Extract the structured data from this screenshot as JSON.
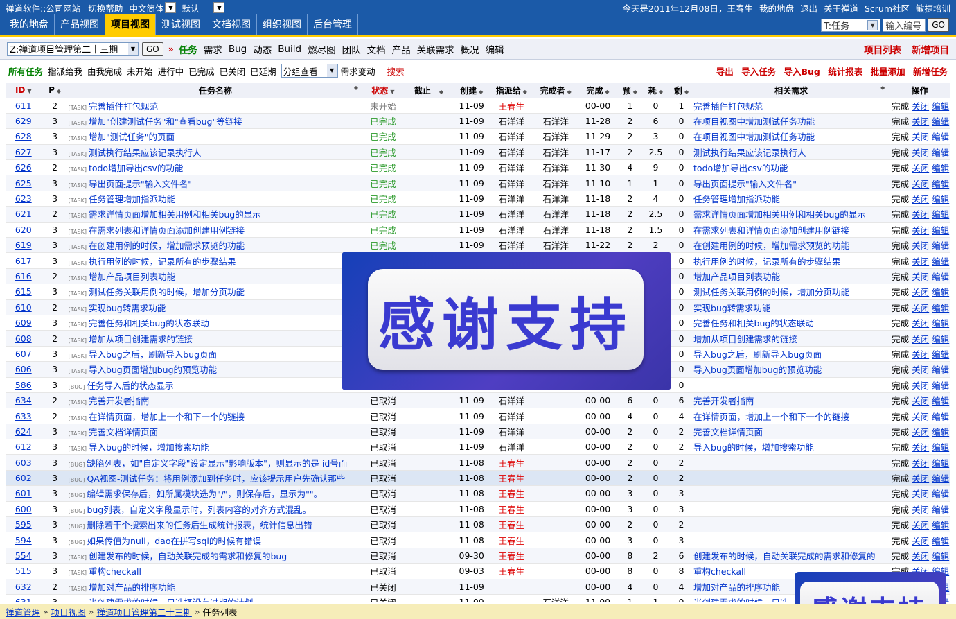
{
  "topbar": {
    "links": [
      "禅道软件::公司网站",
      "切换帮助"
    ],
    "lang": "中文简体",
    "theme": "默认",
    "right": [
      "今天是2011年12月08日，王春生",
      "我的地盘",
      "退出",
      "关于禅道",
      "Scrum社区",
      "敏捷培训"
    ]
  },
  "mainnav": {
    "tabs": [
      "我的地盘",
      "产品视图",
      "项目视图",
      "测试视图",
      "文档视图",
      "组织视图",
      "后台管理"
    ],
    "active": 2,
    "search_type": "T:任务",
    "search_placeholder": "输入编号",
    "go": "GO"
  },
  "projbar": {
    "project": "Z:禅道项目管理第二十三期",
    "go": "GO",
    "sep": "»",
    "items": [
      "任务",
      "需求",
      "Bug",
      "动态",
      "Build",
      "燃尽图",
      "团队",
      "文档",
      "产品",
      "关联需求",
      "概况",
      "编辑"
    ],
    "right": [
      "项目列表",
      "新增项目"
    ]
  },
  "filterbar": {
    "items": [
      "所有任务",
      "指派给我",
      "由我完成",
      "未开始",
      "进行中",
      "已完成",
      "已关闭",
      "已延期"
    ],
    "group": "分组查看",
    "story_change": "需求变动",
    "search": "搜索",
    "right": [
      "导出",
      "导入任务",
      "导入Bug",
      "统计报表",
      "批量添加",
      "新增任务"
    ]
  },
  "table": {
    "headers": [
      "ID",
      "P",
      "任务名称",
      "状态",
      "截止",
      "创建",
      "指派给",
      "完成者",
      "完成",
      "预",
      "耗",
      "剩",
      "相关需求",
      "操作"
    ],
    "ops": [
      "完成",
      "关闭",
      "编辑"
    ],
    "rows": [
      {
        "id": "611",
        "p": "2",
        "tag": "[TASK]",
        "name": "完善插件打包规范",
        "status": "未开始",
        "deadline": "",
        "created": "11-09",
        "assigned": "王春生",
        "assigned_red": true,
        "finisher": "",
        "finished": "00-00",
        "est": "1",
        "consumed": "0",
        "left": "1",
        "story": "完善插件打包规范"
      },
      {
        "id": "629",
        "p": "3",
        "tag": "[TASK]",
        "name": "增加\"创建测试任务\"和\"查看bug\"等链接",
        "status": "已完成",
        "deadline": "",
        "created": "11-09",
        "assigned": "石洋洋",
        "assigned_red": false,
        "finisher": "石洋洋",
        "finished": "11-28",
        "est": "2",
        "consumed": "6",
        "left": "0",
        "story": "在项目视图中增加测试任务功能"
      },
      {
        "id": "628",
        "p": "3",
        "tag": "[TASK]",
        "name": "增加\"测试任务\"的页面",
        "status": "已完成",
        "deadline": "",
        "created": "11-09",
        "assigned": "石洋洋",
        "assigned_red": false,
        "finisher": "石洋洋",
        "finished": "11-29",
        "est": "2",
        "consumed": "3",
        "left": "0",
        "story": "在项目视图中增加测试任务功能"
      },
      {
        "id": "627",
        "p": "3",
        "tag": "[TASK]",
        "name": "测试执行结果应该记录执行人",
        "status": "已完成",
        "deadline": "",
        "created": "11-09",
        "assigned": "石洋洋",
        "assigned_red": false,
        "finisher": "石洋洋",
        "finished": "11-17",
        "est": "2",
        "consumed": "2.5",
        "left": "0",
        "story": "测试执行结果应该记录执行人"
      },
      {
        "id": "626",
        "p": "2",
        "tag": "[TASK]",
        "name": "todo增加导出csv的功能",
        "status": "已完成",
        "deadline": "",
        "created": "11-09",
        "assigned": "石洋洋",
        "assigned_red": false,
        "finisher": "石洋洋",
        "finished": "11-30",
        "est": "4",
        "consumed": "9",
        "left": "0",
        "story": "todo增加导出csv的功能"
      },
      {
        "id": "625",
        "p": "3",
        "tag": "[TASK]",
        "name": "导出页面提示\"输入文件名\"",
        "status": "已完成",
        "deadline": "",
        "created": "11-09",
        "assigned": "石洋洋",
        "assigned_red": false,
        "finisher": "石洋洋",
        "finished": "11-10",
        "est": "1",
        "consumed": "1",
        "left": "0",
        "story": "导出页面提示\"输入文件名\""
      },
      {
        "id": "623",
        "p": "3",
        "tag": "[TASK]",
        "name": "任务管理增加指派功能",
        "status": "已完成",
        "deadline": "",
        "created": "11-09",
        "assigned": "石洋洋",
        "assigned_red": false,
        "finisher": "石洋洋",
        "finished": "11-18",
        "est": "2",
        "consumed": "4",
        "left": "0",
        "story": "任务管理增加指派功能"
      },
      {
        "id": "621",
        "p": "2",
        "tag": "[TASK]",
        "name": "需求详情页面增加相关用例和相关bug的显示",
        "status": "已完成",
        "deadline": "",
        "created": "11-09",
        "assigned": "石洋洋",
        "assigned_red": false,
        "finisher": "石洋洋",
        "finished": "11-18",
        "est": "2",
        "consumed": "2.5",
        "left": "0",
        "story": "需求详情页面增加相关用例和相关bug的显示"
      },
      {
        "id": "620",
        "p": "3",
        "tag": "[TASK]",
        "name": "在需求列表和详情页面添加创建用例链接",
        "status": "已完成",
        "deadline": "",
        "created": "11-09",
        "assigned": "石洋洋",
        "assigned_red": false,
        "finisher": "石洋洋",
        "finished": "11-18",
        "est": "2",
        "consumed": "1.5",
        "left": "0",
        "story": "在需求列表和详情页面添加创建用例链接"
      },
      {
        "id": "619",
        "p": "3",
        "tag": "[TASK]",
        "name": "在创建用例的时候，增加需求预览的功能",
        "status": "已完成",
        "deadline": "",
        "created": "11-09",
        "assigned": "石洋洋",
        "assigned_red": false,
        "finisher": "石洋洋",
        "finished": "11-22",
        "est": "2",
        "consumed": "2",
        "left": "0",
        "story": "在创建用例的时候，增加需求预览的功能"
      },
      {
        "id": "617",
        "p": "3",
        "tag": "[TASK]",
        "name": "执行用例的时候，记录所有的步骤结果",
        "status": "",
        "deadline": "",
        "created": "",
        "assigned": "",
        "assigned_red": false,
        "finisher": "",
        "finished": "",
        "est": "",
        "consumed": "",
        "left": "0",
        "story": "执行用例的时候，记录所有的步骤结果"
      },
      {
        "id": "616",
        "p": "2",
        "tag": "[TASK]",
        "name": "增加产品项目列表功能",
        "status": "",
        "deadline": "",
        "created": "",
        "assigned": "",
        "assigned_red": false,
        "finisher": "",
        "finished": "",
        "est": "",
        "consumed": "",
        "left": "0",
        "story": "增加产品项目列表功能"
      },
      {
        "id": "615",
        "p": "3",
        "tag": "[TASK]",
        "name": "测试任务关联用例的时候，增加分页功能",
        "status": "",
        "deadline": "",
        "created": "",
        "assigned": "",
        "assigned_red": false,
        "finisher": "",
        "finished": "",
        "est": "",
        "consumed": "",
        "left": "0",
        "story": "测试任务关联用例的时候，增加分页功能"
      },
      {
        "id": "610",
        "p": "2",
        "tag": "[TASK]",
        "name": "实现bug转需求功能",
        "status": "",
        "deadline": "",
        "created": "",
        "assigned": "",
        "assigned_red": false,
        "finisher": "",
        "finished": "",
        "est": "",
        "consumed": "",
        "left": "0",
        "story": "实现bug转需求功能"
      },
      {
        "id": "609",
        "p": "3",
        "tag": "[TASK]",
        "name": "完善任务和相关bug的状态联动",
        "status": "",
        "deadline": "",
        "created": "",
        "assigned": "",
        "assigned_red": false,
        "finisher": "",
        "finished": "",
        "est": "",
        "consumed": "",
        "left": "0",
        "story": "完善任务和相关bug的状态联动"
      },
      {
        "id": "608",
        "p": "2",
        "tag": "[TASK]",
        "name": "增加从项目创建需求的链接",
        "status": "",
        "deadline": "",
        "created": "",
        "assigned": "",
        "assigned_red": false,
        "finisher": "",
        "finished": "",
        "est": "",
        "consumed": "",
        "left": "0",
        "story": "增加从项目创建需求的链接"
      },
      {
        "id": "607",
        "p": "3",
        "tag": "[TASK]",
        "name": "导入bug之后，刷新导入bug页面",
        "status": "",
        "deadline": "",
        "created": "",
        "assigned": "",
        "assigned_red": false,
        "finisher": "",
        "finished": "",
        "est": "",
        "consumed": "",
        "left": "0",
        "story": "导入bug之后，刷新导入bug页面"
      },
      {
        "id": "606",
        "p": "3",
        "tag": "[TASK]",
        "name": "导入bug页面增加bug的预览功能",
        "status": "",
        "deadline": "",
        "created": "",
        "assigned": "",
        "assigned_red": false,
        "finisher": "",
        "finished": "",
        "est": "",
        "consumed": "",
        "left": "0",
        "story": "导入bug页面增加bug的预览功能"
      },
      {
        "id": "586",
        "p": "3",
        "tag": "[BUG]",
        "name": "任务导入后的状态显示",
        "status": "",
        "deadline": "",
        "created": "",
        "assigned": "",
        "assigned_red": false,
        "finisher": "",
        "finished": "",
        "est": "",
        "consumed": "",
        "left": "0",
        "story": ""
      },
      {
        "id": "634",
        "p": "2",
        "tag": "[TASK]",
        "name": "完善开发者指南",
        "status": "已取消",
        "deadline": "",
        "created": "11-09",
        "assigned": "石洋洋",
        "assigned_red": false,
        "finisher": "",
        "finished": "00-00",
        "est": "6",
        "consumed": "0",
        "left": "6",
        "story": "完善开发者指南"
      },
      {
        "id": "633",
        "p": "2",
        "tag": "[TASK]",
        "name": "在详情页面，增加上一个和下一个的链接",
        "status": "已取消",
        "deadline": "",
        "created": "11-09",
        "assigned": "石洋洋",
        "assigned_red": false,
        "finisher": "",
        "finished": "00-00",
        "est": "4",
        "consumed": "0",
        "left": "4",
        "story": "在详情页面，增加上一个和下一个的链接"
      },
      {
        "id": "624",
        "p": "3",
        "tag": "[TASK]",
        "name": "完善文档详情页面",
        "status": "已取消",
        "deadline": "",
        "created": "11-09",
        "assigned": "石洋洋",
        "assigned_red": false,
        "finisher": "",
        "finished": "00-00",
        "est": "2",
        "consumed": "0",
        "left": "2",
        "story": "完善文档详情页面"
      },
      {
        "id": "612",
        "p": "3",
        "tag": "[TASK]",
        "name": "导入bug的时候，增加搜索功能",
        "status": "已取消",
        "deadline": "",
        "created": "11-09",
        "assigned": "石洋洋",
        "assigned_red": false,
        "finisher": "",
        "finished": "00-00",
        "est": "2",
        "consumed": "0",
        "left": "2",
        "story": "导入bug的时候，增加搜索功能"
      },
      {
        "id": "603",
        "p": "3",
        "tag": "[BUG]",
        "name": "缺陷列表，如\"自定义字段\"设定显示\"影响版本\"，则显示的是 id号而",
        "status": "已取消",
        "deadline": "",
        "created": "11-08",
        "assigned": "王春生",
        "assigned_red": true,
        "finisher": "",
        "finished": "00-00",
        "est": "2",
        "consumed": "0",
        "left": "2",
        "story": ""
      },
      {
        "id": "602",
        "p": "3",
        "tag": "[BUG]",
        "name": "QA视图-测试任务：将用例添加到任务时，应该提示用户先确认那些",
        "status": "已取消",
        "deadline": "",
        "created": "11-08",
        "assigned": "王春生",
        "assigned_red": true,
        "finisher": "",
        "finished": "00-00",
        "est": "2",
        "consumed": "0",
        "left": "2",
        "story": ""
      },
      {
        "id": "601",
        "p": "3",
        "tag": "[BUG]",
        "name": "编辑需求保存后，如所属模块选为\"/\"，则保存后，显示为\"\"。",
        "status": "已取消",
        "deadline": "",
        "created": "11-08",
        "assigned": "王春生",
        "assigned_red": true,
        "finisher": "",
        "finished": "00-00",
        "est": "3",
        "consumed": "0",
        "left": "3",
        "story": ""
      },
      {
        "id": "600",
        "p": "3",
        "tag": "[BUG]",
        "name": "bug列表，自定义字段显示时，列表内容的对齐方式混乱。",
        "status": "已取消",
        "deadline": "",
        "created": "11-08",
        "assigned": "王春生",
        "assigned_red": true,
        "finisher": "",
        "finished": "00-00",
        "est": "3",
        "consumed": "0",
        "left": "3",
        "story": ""
      },
      {
        "id": "595",
        "p": "3",
        "tag": "[BUG]",
        "name": "删除若干个搜索出来的任务后生成统计报表，统计信息出错",
        "status": "已取消",
        "deadline": "",
        "created": "11-08",
        "assigned": "王春生",
        "assigned_red": true,
        "finisher": "",
        "finished": "00-00",
        "est": "2",
        "consumed": "0",
        "left": "2",
        "story": ""
      },
      {
        "id": "594",
        "p": "3",
        "tag": "[BUG]",
        "name": "如果传值为null，dao在拼写sql的时候有错误",
        "status": "已取消",
        "deadline": "",
        "created": "11-08",
        "assigned": "王春生",
        "assigned_red": true,
        "finisher": "",
        "finished": "00-00",
        "est": "3",
        "consumed": "0",
        "left": "3",
        "story": ""
      },
      {
        "id": "554",
        "p": "3",
        "tag": "[TASK]",
        "name": "创建发布的时候，自动关联完成的需求和修复的bug",
        "status": "已取消",
        "deadline": "",
        "created": "09-30",
        "assigned": "王春生",
        "assigned_red": true,
        "finisher": "",
        "finished": "00-00",
        "est": "8",
        "consumed": "2",
        "left": "6",
        "story": "创建发布的时候，自动关联完成的需求和修复的"
      },
      {
        "id": "515",
        "p": "3",
        "tag": "[TASK]",
        "name": "重构checkall",
        "status": "已取消",
        "deadline": "",
        "created": "09-03",
        "assigned": "王春生",
        "assigned_red": true,
        "finisher": "",
        "finished": "00-00",
        "est": "8",
        "consumed": "0",
        "left": "8",
        "story": "重构checkall"
      },
      {
        "id": "632",
        "p": "2",
        "tag": "[TASK]",
        "name": "增加对产品的排序功能",
        "status": "已关闭",
        "deadline": "",
        "created": "11-09",
        "assigned": "",
        "assigned_red": false,
        "finisher": "",
        "finished": "00-00",
        "est": "4",
        "consumed": "0",
        "left": "4",
        "story": "增加对产品的排序功能"
      },
      {
        "id": "631",
        "p": "3",
        "tag": "[TASK]",
        "name": "当创建需求的时候，只选择没有过期的计划",
        "status": "已关闭",
        "deadline": "",
        "created": "11-09",
        "assigned": "",
        "assigned_red": false,
        "finisher": "石洋洋",
        "finished": "11-09",
        "est": "1",
        "consumed": "1",
        "left": "0",
        "story": "当创建需求的时候，只选"
      }
    ]
  },
  "footer": {
    "crumbs": [
      "禅道管理",
      "项目视图",
      "禅道项目管理第二十三期"
    ],
    "current": "任务列表",
    "sep": "»"
  },
  "overlay": {
    "text": "感谢支持"
  }
}
